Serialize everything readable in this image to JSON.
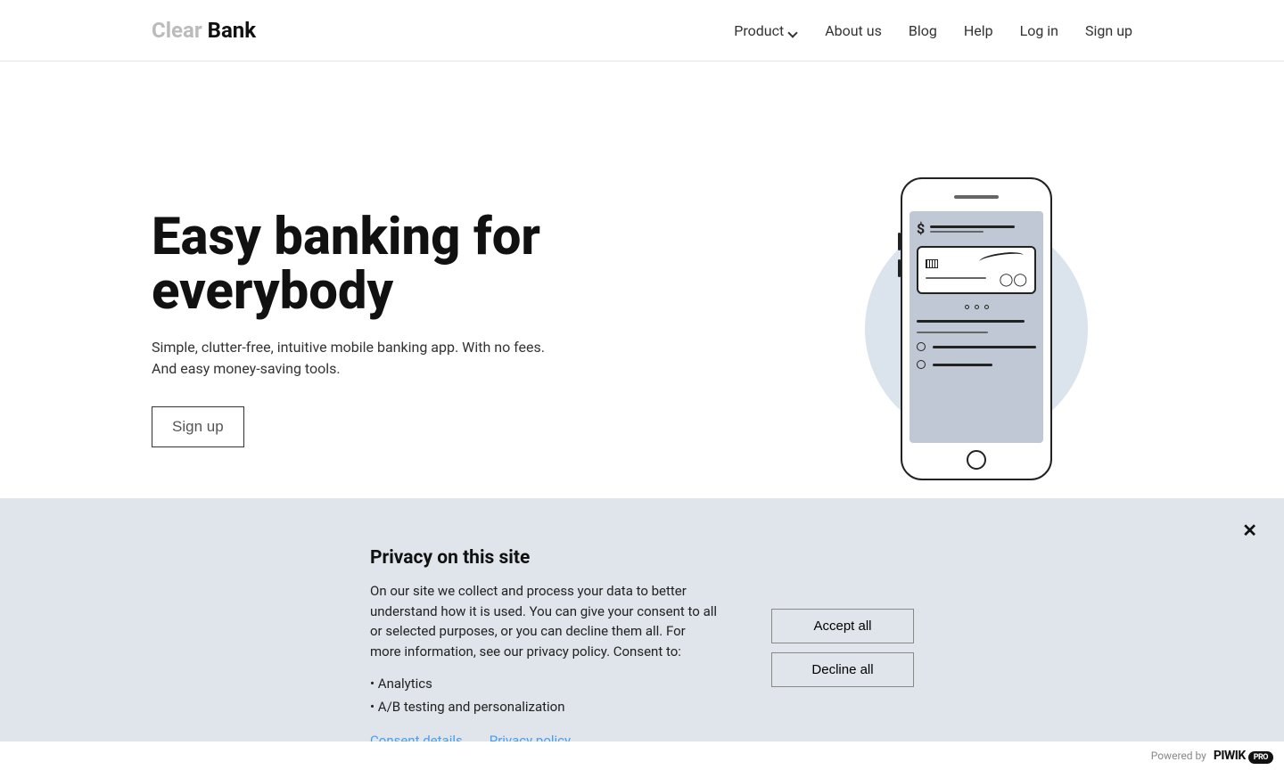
{
  "logo": {
    "part1": "Clear",
    "part2": "Bank"
  },
  "nav": {
    "product": "Product",
    "about": "About us",
    "blog": "Blog",
    "help": "Help",
    "login": "Log in",
    "signup": "Sign up"
  },
  "hero": {
    "title": "Easy banking for everybody",
    "subtitle": "Simple, clutter-free, intuitive mobile banking app. With no fees. And easy money-saving tools.",
    "cta": "Sign up"
  },
  "consent": {
    "title": "Privacy on this site",
    "text": "On our site we collect and process your data to better understand how it is used. You can give your consent to all or selected purposes, or you can decline them all. For more information, see our privacy policy. Consent to:",
    "bullets": [
      "• Analytics",
      "• A/B testing and personalization"
    ],
    "link_details": "Consent details",
    "link_privacy": "Privacy policy",
    "accept": "Accept all",
    "decline": "Decline all",
    "close": "✕",
    "powered_label": "Powered by",
    "piwik_brand": "PIWIK",
    "piwik_badge": "PRO"
  }
}
